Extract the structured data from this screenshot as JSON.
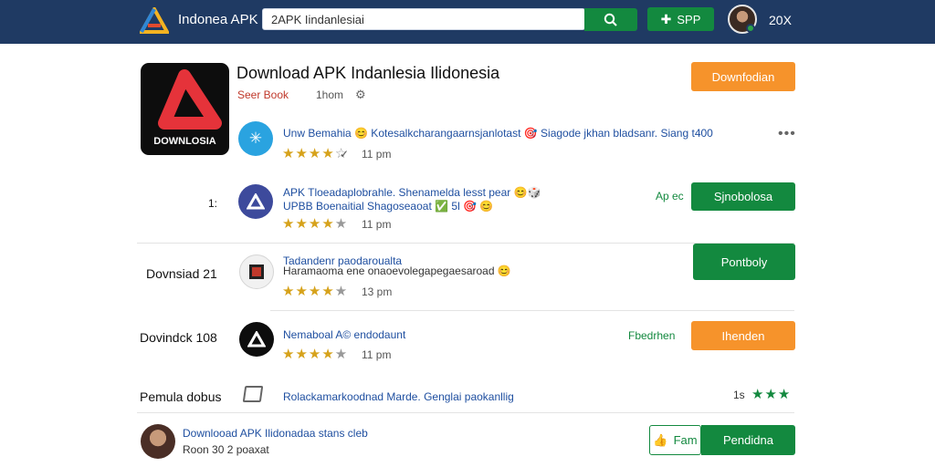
{
  "header": {
    "site_name": "Indonea APK",
    "search_value": "2APK Iindanlesiai",
    "app_button_label": "SPP",
    "count": "20X"
  },
  "main_app": {
    "tile_label": "DOWNLOSIA",
    "title": "Download APK Indanlesia Ilidonesia",
    "developer": "Seer Book",
    "meta": "1hom",
    "button": "Downfodian"
  },
  "rows": [
    {
      "title": "Unw Bemahia 😊 Kotesalkcharangaarnsjanlotast 🎯 Siagode jkhan bladsanr. Siang t400",
      "time": "11 pm",
      "more": "•••"
    },
    {
      "left_label": "1:",
      "title_1": "APK Tloeadaplobrahle. Shenamelda lesst pear 😊🎲",
      "title_2": "UPBB Boenaitial Shagoseaoat ✅ 5l 🎯 😊",
      "time": "11 pm",
      "green_label": "Ap ec",
      "button": "Sjnobolosa"
    },
    {
      "left_label": "Dovnsiad 21",
      "title_1": "Tadandenr paodaroualta",
      "title_2": "Haramaoma ene onaoevolegapegaesaroad 😊",
      "time": "13 pm",
      "button": "Pontboly"
    },
    {
      "left_label": "Dovindck 108",
      "title": "Nemaboal A© endodaunt",
      "time": "11 pm",
      "green_label": "Fbedrhen",
      "button": "Ihenden"
    },
    {
      "left_label": "Pemula dobus",
      "title": "Rolackamarkoodnad Marde. Genglai paokanllig",
      "right_text": "1s"
    },
    {
      "title": "Downlooad APK Ilidonadaa stans cleb",
      "meta": "Roon 30 2 poaxat",
      "like_label": "Fam",
      "button": "Pendidna"
    }
  ]
}
